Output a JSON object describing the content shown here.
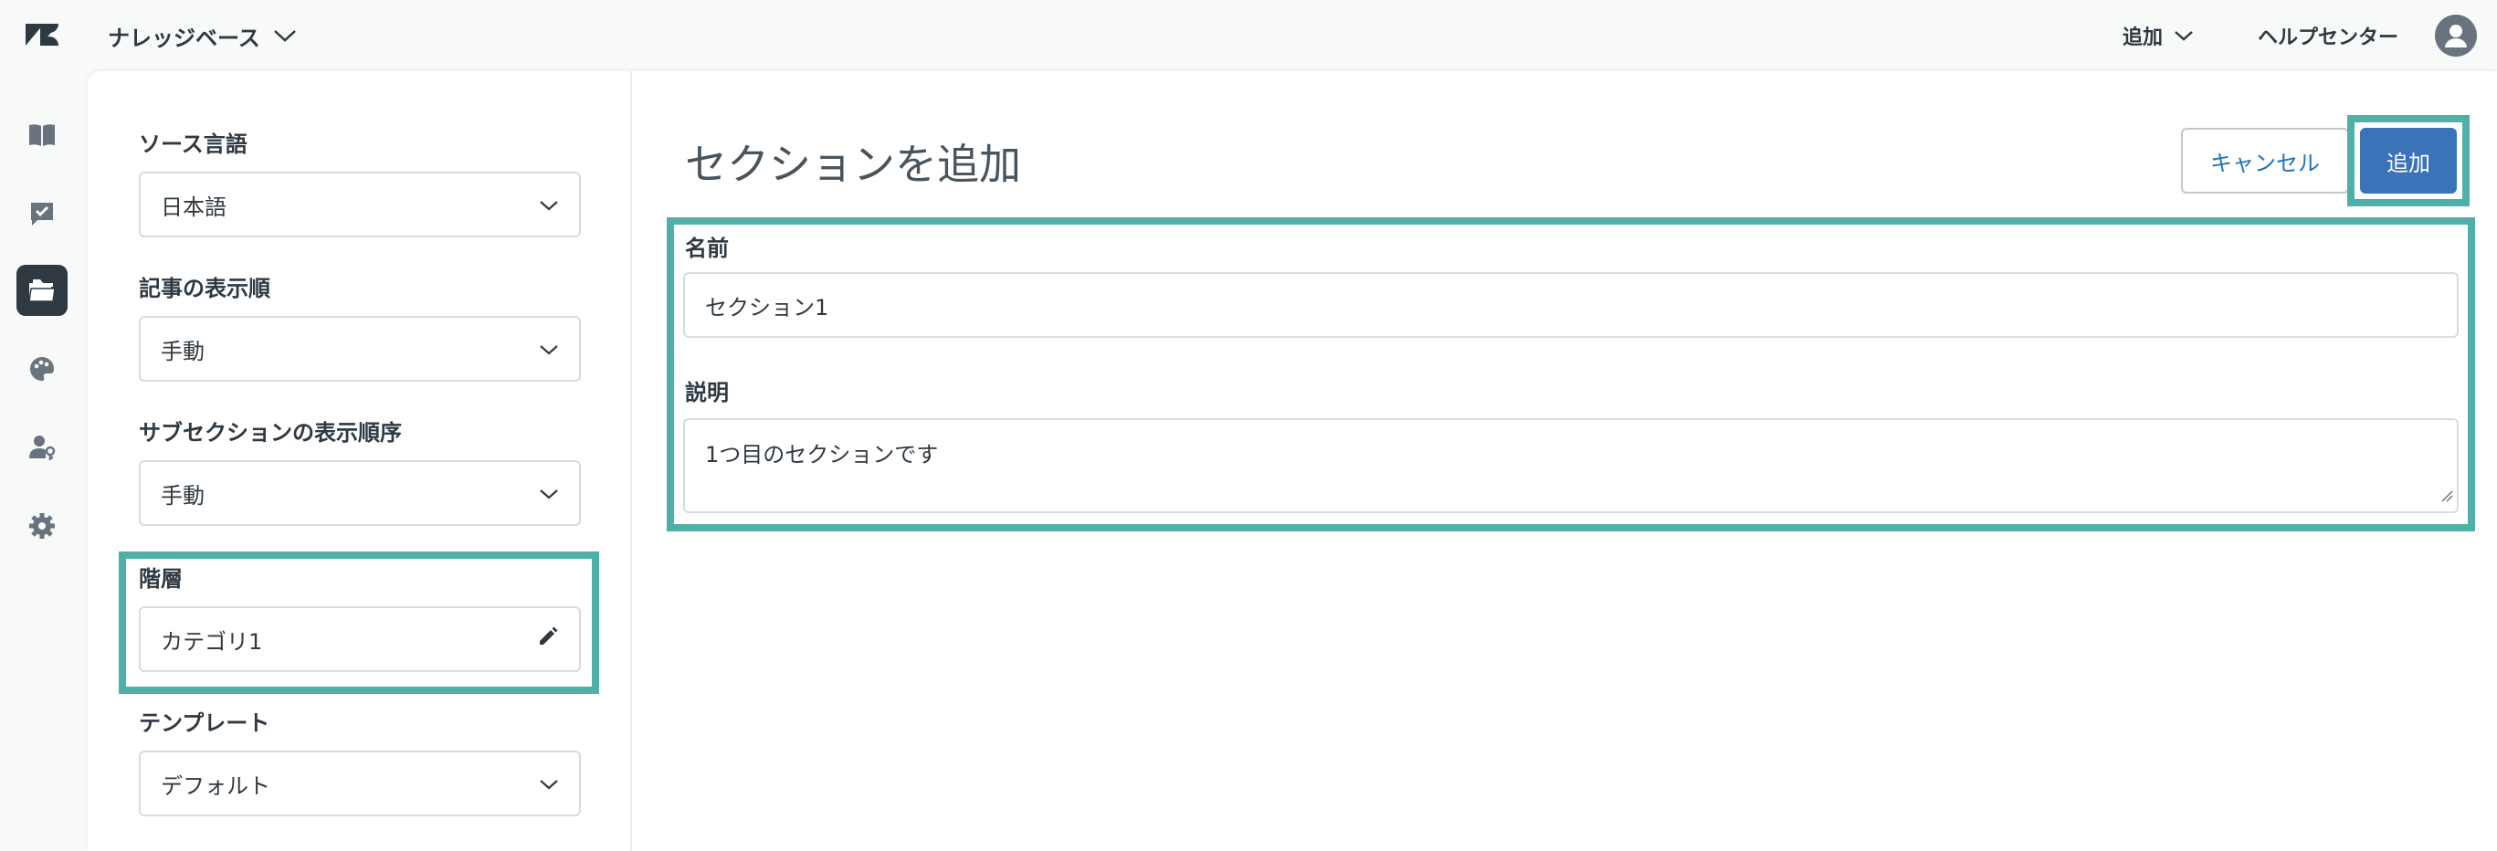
{
  "header": {
    "product_name": "ナレッジベース",
    "add_menu_label": "追加",
    "help_center_label": "ヘルプセンター"
  },
  "nav": {
    "items": [
      {
        "icon": "book-icon"
      },
      {
        "icon": "checklist-icon"
      },
      {
        "icon": "folder-icon",
        "active": true
      },
      {
        "icon": "palette-icon"
      },
      {
        "icon": "user-permissions-icon"
      },
      {
        "icon": "gear-icon"
      }
    ]
  },
  "sidepanel": {
    "source_language": {
      "label": "ソース言語",
      "value": "日本語"
    },
    "article_order": {
      "label": "記事の表示順",
      "value": "手動"
    },
    "subsection_order": {
      "label": "サブセクションの表示順序",
      "value": "手動"
    },
    "hierarchy": {
      "label": "階層",
      "value": "カテゴリ1"
    },
    "template": {
      "label": "テンプレート",
      "value": "デフォルト"
    }
  },
  "main": {
    "title": "セクションを追加",
    "cancel_label": "キャンセル",
    "add_label": "追加",
    "name_field": {
      "label": "名前",
      "value": "セクション1"
    },
    "description_field": {
      "label": "説明",
      "value": "1つ目のセクションです"
    }
  },
  "colors": {
    "highlight": "#4fb0a7",
    "primary_button": "#3b73b9",
    "link": "#1f73b7"
  }
}
